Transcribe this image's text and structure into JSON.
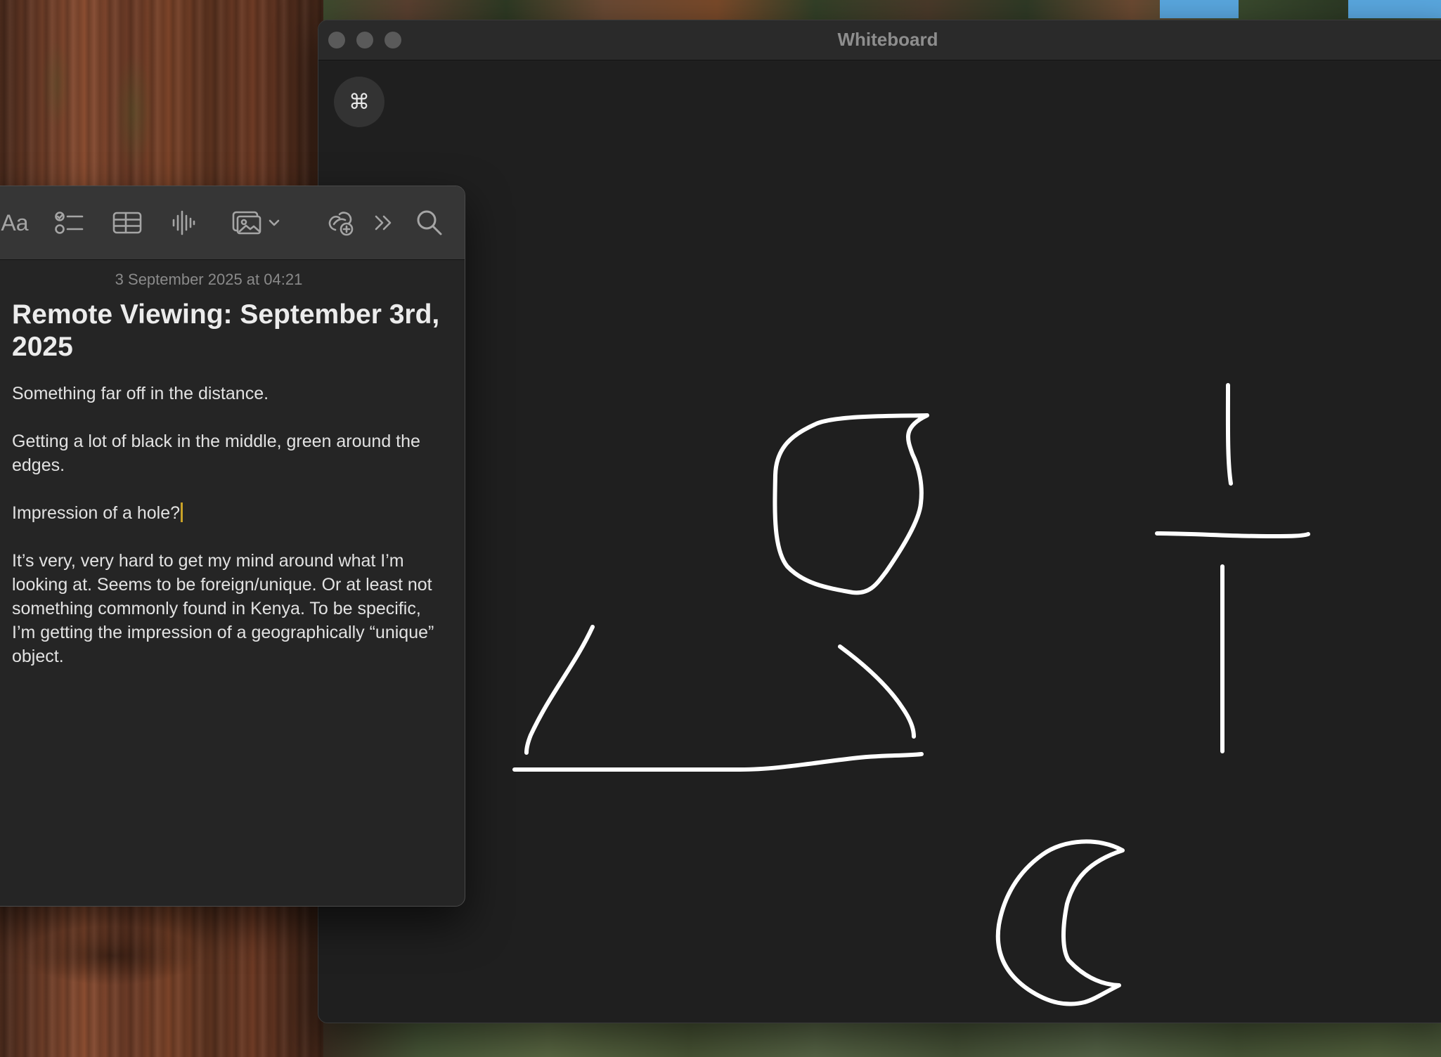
{
  "whiteboard_window": {
    "title": "Whiteboard",
    "command_button_glyph": "⌘",
    "drawings": [
      {
        "name": "circle-sketch"
      },
      {
        "name": "triangle-sketch"
      },
      {
        "name": "cross-sketch"
      },
      {
        "name": "crescent-sketch"
      }
    ]
  },
  "notes_window": {
    "toolbar": {
      "format_label": "Aa",
      "icons": [
        "checklist-icon",
        "table-icon",
        "audio-icon",
        "media-icon",
        "collaborate-icon",
        "more-icon",
        "search-icon"
      ]
    },
    "note": {
      "date": "3 September 2025 at 04:21",
      "title": "Remote Viewing: September 3rd, 2025",
      "paragraphs": [
        "Something far off in the distance.",
        "Getting a lot of black in the middle, green around the edges.",
        "Impression of a hole?",
        "It’s very, very hard to get my mind around what I’m looking at. Seems to be foreign/unique. Or at least not something commonly found in Kenya. To be specific, I’m getting the impression of a geographically “unique” object."
      ]
    }
  },
  "colors": {
    "canvas_background": "#1f1f1f",
    "stroke": "#ffffff",
    "notes_background": "#252525",
    "caret": "#c9a227"
  }
}
